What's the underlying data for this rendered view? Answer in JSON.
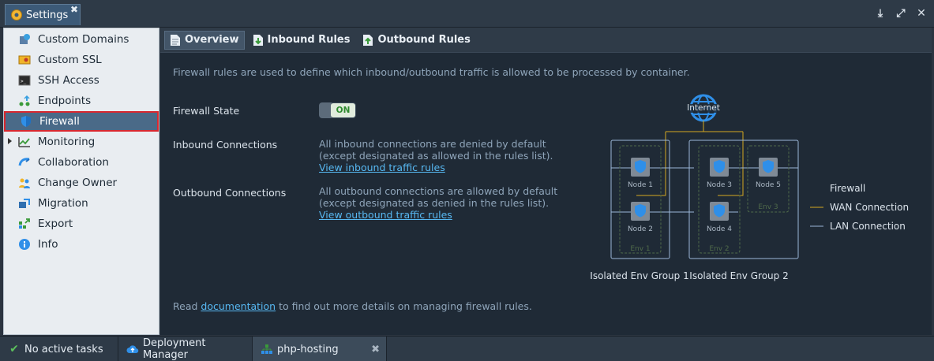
{
  "window": {
    "tab_title": "Settings",
    "icons": [
      "download-icon",
      "maximize-icon",
      "close-icon"
    ]
  },
  "sidebar": {
    "items": [
      {
        "label": "Custom Domains",
        "icon": "domains-icon"
      },
      {
        "label": "Custom SSL",
        "icon": "ssl-icon"
      },
      {
        "label": "SSH Access",
        "icon": "terminal-icon"
      },
      {
        "label": "Endpoints",
        "icon": "endpoints-icon"
      },
      {
        "label": "Firewall",
        "icon": "shield-icon",
        "active": true
      },
      {
        "label": "Monitoring",
        "icon": "monitoring-icon"
      },
      {
        "label": "Collaboration",
        "icon": "collaboration-icon"
      },
      {
        "label": "Change Owner",
        "icon": "users-icon"
      },
      {
        "label": "Migration",
        "icon": "migration-icon"
      },
      {
        "label": "Export",
        "icon": "export-icon"
      },
      {
        "label": "Info",
        "icon": "info-icon"
      }
    ]
  },
  "subtabs": {
    "overview": "Overview",
    "inbound": "Inbound Rules",
    "outbound": "Outbound Rules"
  },
  "overview": {
    "description": "Firewall rules are used to define which inbound/outbound traffic is allowed to be processed by container.",
    "firewall_state_label": "Firewall State",
    "toggle_label": "ON",
    "inbound_label": "Inbound Connections",
    "inbound_line1": "All inbound connections are denied by default",
    "inbound_line2": "(except designated as allowed in the rules list).",
    "inbound_link": "View inbound traffic rules",
    "outbound_label": "Outbound Connections",
    "outbound_line1": "All outbound connections are allowed by default",
    "outbound_line2": "(except designated as denied in the rules list).",
    "outbound_link": "View outbound traffic rules",
    "doc_read": "Read",
    "doc_link": "documentation",
    "doc_rest": "to find out more details on managing firewall rules."
  },
  "diagram": {
    "internet": "Internet",
    "nodes": [
      "Node 1",
      "Node 2",
      "Node 3",
      "Node 4",
      "Node 5"
    ],
    "envs": [
      "Env 1",
      "Env 2",
      "Env 3"
    ],
    "groups": [
      "Isolated Env Group 1",
      "Isolated Env Group 2"
    ],
    "legend_title": "Firewall",
    "legend_wan": "WAN Connection",
    "legend_lan": "LAN Connection",
    "colors": {
      "wan": "#d4a820",
      "lan": "#9bb7d8",
      "node": "#7f8a96",
      "env_border": "#4f6a4a"
    }
  },
  "bottombar": {
    "tasks": "No active tasks",
    "deployment": "Deployment Manager",
    "env": "php-hosting"
  }
}
